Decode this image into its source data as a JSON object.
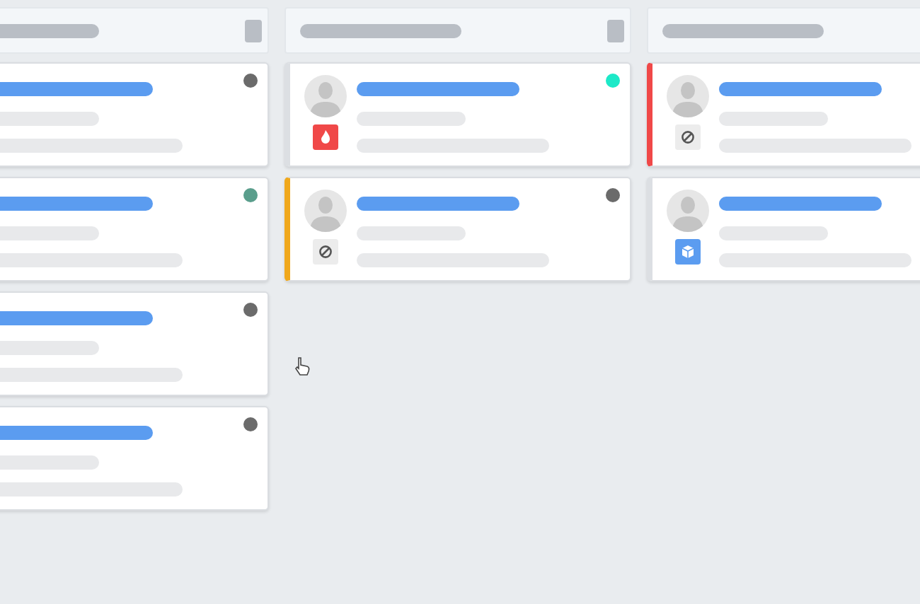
{
  "board": {
    "columns": [
      {
        "menu_button": true,
        "cards": [
          {
            "color": "#6b6b6b"
          },
          {
            "color": "#5a9e8c"
          },
          {
            "color": "#6b6b6b"
          },
          {
            "color": "#6b6b6b"
          }
        ]
      },
      {
        "menu_button": true,
        "cards": [
          {
            "stripe": {
              "color": "#dcdfe3"
            },
            "color": "#1de9c8",
            "tag": {
              "kind": "fire"
            }
          },
          {
            "stripe": {
              "color": "#f0a81c"
            },
            "color": "#6b6b6b",
            "tag": {
              "kind": "blocked"
            }
          }
        ]
      },
      {
        "cards": [
          {
            "stripe": {
              "color": "#f04848"
            },
            "tag": {
              "kind": "blocked"
            }
          },
          {
            "stripe": {
              "color": "#dcdfe3"
            },
            "tag": {
              "kind": "box"
            }
          }
        ]
      }
    ]
  }
}
